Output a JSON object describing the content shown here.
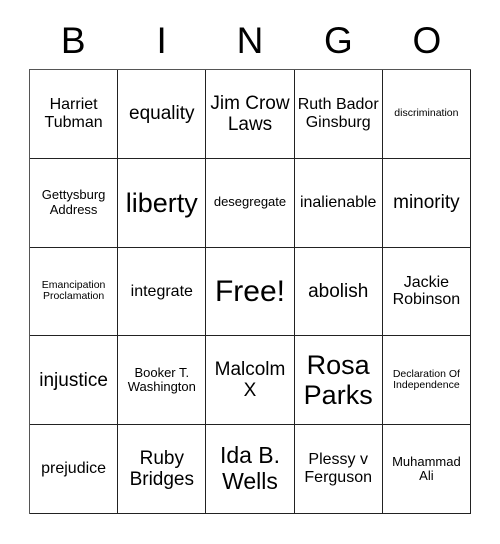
{
  "card": {
    "title": "BINGO Card",
    "header_letters": [
      "B",
      "I",
      "N",
      "G",
      "O"
    ],
    "columns": 5,
    "rows": 5,
    "free_space_label": "Free!",
    "free_space_position": "center",
    "background_color": "#ffffff",
    "text_color": "#000000",
    "border_color": "#222222"
  },
  "grid": {
    "rows": [
      {
        "cells": [
          {
            "text": "Harriet Tubman",
            "size": "m"
          },
          {
            "text": "equality",
            "size": "l"
          },
          {
            "text": "Jim Crow Laws",
            "size": "l"
          },
          {
            "text": "Ruth Bador Ginsburg",
            "size": "m"
          },
          {
            "text": "discrimination",
            "size": "xs"
          }
        ]
      },
      {
        "cells": [
          {
            "text": "Gettysburg Address",
            "size": "s"
          },
          {
            "text": "liberty",
            "size": "xxl"
          },
          {
            "text": "desegregate",
            "size": "s"
          },
          {
            "text": "inalienable",
            "size": "m"
          },
          {
            "text": "minority",
            "size": "l"
          }
        ]
      },
      {
        "cells": [
          {
            "text": "Emancipation Proclamation",
            "size": "xs"
          },
          {
            "text": "integrate",
            "size": "m"
          },
          {
            "text": "Free!",
            "size": "free"
          },
          {
            "text": "abolish",
            "size": "l"
          },
          {
            "text": "Jackie Robinson",
            "size": "m"
          }
        ]
      },
      {
        "cells": [
          {
            "text": "injustice",
            "size": "l"
          },
          {
            "text": "Booker T. Washington",
            "size": "s"
          },
          {
            "text": "Malcolm X",
            "size": "l"
          },
          {
            "text": "Rosa Parks",
            "size": "xxl"
          },
          {
            "text": "Declaration Of Independence",
            "size": "xs"
          }
        ]
      },
      {
        "cells": [
          {
            "text": "prejudice",
            "size": "m"
          },
          {
            "text": "Ruby Bridges",
            "size": "l"
          },
          {
            "text": "Ida B. Wells",
            "size": "xl"
          },
          {
            "text": "Plessy v Ferguson",
            "size": "m"
          },
          {
            "text": "Muhammad Ali",
            "size": "s"
          }
        ]
      }
    ]
  }
}
